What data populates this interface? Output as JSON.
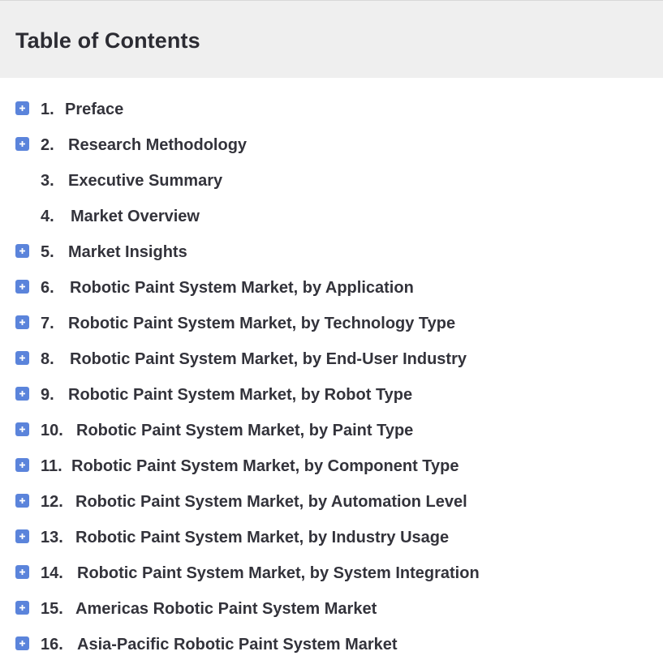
{
  "header": {
    "title": "Table of Contents"
  },
  "colors": {
    "header_bg": "#efefef",
    "icon_bg": "#5b84db",
    "text": "#33333b"
  },
  "toc": {
    "items": [
      {
        "number": "1.",
        "label": "Preface",
        "expandable": true,
        "icon": "plus-icon"
      },
      {
        "number": "2.",
        "label": "Research Methodology",
        "expandable": true,
        "icon": "plus-icon"
      },
      {
        "number": "3.",
        "label": "Executive Summary",
        "expandable": false
      },
      {
        "number": "4.",
        "label": "Market Overview",
        "expandable": false
      },
      {
        "number": "5.",
        "label": "Market Insights",
        "expandable": true,
        "icon": "plus-icon"
      },
      {
        "number": "6.",
        "label": "Robotic Paint System Market, by Application",
        "expandable": true,
        "icon": "plus-icon"
      },
      {
        "number": "7.",
        "label": "Robotic Paint System Market, by Technology Type",
        "expandable": true,
        "icon": "plus-icon"
      },
      {
        "number": "8.",
        "label": "Robotic Paint System Market, by End-User Industry",
        "expandable": true,
        "icon": "plus-icon"
      },
      {
        "number": "9.",
        "label": "Robotic Paint System Market, by Robot Type",
        "expandable": true,
        "icon": "plus-icon"
      },
      {
        "number": "10.",
        "label": "Robotic Paint System Market, by Paint Type",
        "expandable": true,
        "icon": "plus-icon"
      },
      {
        "number": "11.",
        "label": "Robotic Paint System Market, by Component Type",
        "expandable": true,
        "icon": "plus-icon"
      },
      {
        "number": "12.",
        "label": "Robotic Paint System Market, by Automation Level",
        "expandable": true,
        "icon": "plus-icon"
      },
      {
        "number": "13.",
        "label": "Robotic Paint System Market, by Industry Usage",
        "expandable": true,
        "icon": "plus-icon"
      },
      {
        "number": "14.",
        "label": "Robotic Paint System Market, by System Integration",
        "expandable": true,
        "icon": "plus-icon"
      },
      {
        "number": "15.",
        "label": "Americas Robotic Paint System Market",
        "expandable": true,
        "icon": "plus-icon"
      },
      {
        "number": "16.",
        "label": "Asia-Pacific Robotic Paint System Market",
        "expandable": true,
        "icon": "plus-icon"
      }
    ]
  }
}
